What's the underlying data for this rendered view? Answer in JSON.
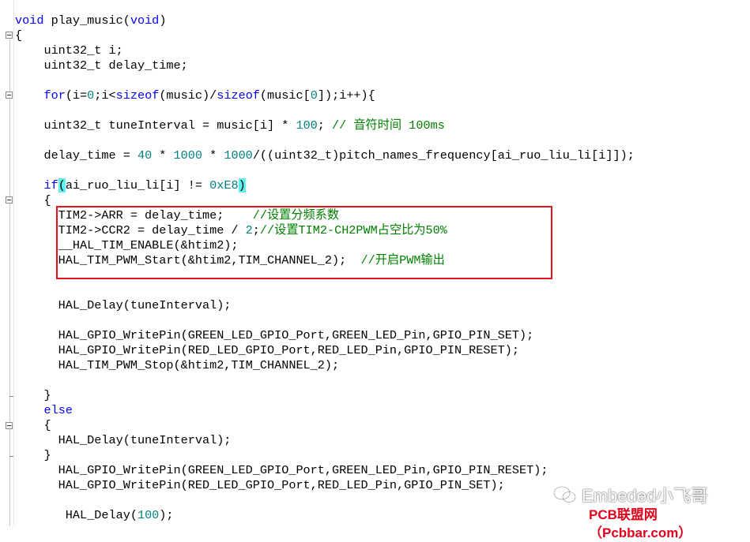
{
  "code": {
    "lines": [
      {
        "id": "l1",
        "parts": [
          {
            "t": "void",
            "c": "kw"
          },
          {
            "t": " play_music("
          },
          {
            "t": "void",
            "c": "kw"
          },
          {
            "t": ")"
          }
        ]
      },
      {
        "id": "l2",
        "parts": [
          {
            "t": "{"
          }
        ]
      },
      {
        "id": "l3",
        "parts": [
          {
            "t": "    uint32_t i;"
          }
        ]
      },
      {
        "id": "l4",
        "parts": [
          {
            "t": "    uint32_t delay_time;"
          }
        ]
      },
      {
        "id": "l5",
        "parts": [
          {
            "t": "    "
          },
          {
            "t": "for",
            "c": "kw"
          },
          {
            "t": "(i="
          },
          {
            "t": "0",
            "c": "num"
          },
          {
            "t": ";i<"
          },
          {
            "t": "sizeof",
            "c": "kw"
          },
          {
            "t": "(music)/"
          },
          {
            "t": "sizeof",
            "c": "kw"
          },
          {
            "t": "(music["
          },
          {
            "t": "0",
            "c": "num"
          },
          {
            "t": "]);i++){"
          }
        ]
      },
      {
        "id": "l6",
        "parts": [
          {
            "t": "    uint32_t tuneInterval = music[i] * "
          },
          {
            "t": "100",
            "c": "num"
          },
          {
            "t": "; "
          },
          {
            "t": "// 音符时间 100ms",
            "c": "cm"
          }
        ]
      },
      {
        "id": "l7",
        "parts": [
          {
            "t": "    delay_time = "
          },
          {
            "t": "40",
            "c": "num"
          },
          {
            "t": " * "
          },
          {
            "t": "1000",
            "c": "num"
          },
          {
            "t": " * "
          },
          {
            "t": "1000",
            "c": "num"
          },
          {
            "t": "/((uint32_t)pitch_names_frequency[ai_ruo_liu_li[i]]);"
          }
        ]
      },
      {
        "id": "l8",
        "parts": [
          {
            "t": "    "
          },
          {
            "t": "if",
            "c": "kw"
          },
          {
            "t": "(",
            "c": "hl"
          },
          {
            "t": "ai_ruo_liu_li[i] != "
          },
          {
            "t": "0xE8",
            "c": "num"
          },
          {
            "t": ")",
            "c": "hl"
          }
        ]
      },
      {
        "id": "l9",
        "parts": [
          {
            "t": "    {"
          }
        ]
      },
      {
        "id": "l10",
        "parts": [
          {
            "t": "      TIM2->ARR = delay_time;    "
          },
          {
            "t": "//设置分频系数",
            "c": "cm"
          }
        ]
      },
      {
        "id": "l11",
        "parts": [
          {
            "t": "      TIM2->CCR2 = delay_time / "
          },
          {
            "t": "2",
            "c": "num"
          },
          {
            "t": ";"
          },
          {
            "t": "//设置TIM2-CH2PWM占空比为50%",
            "c": "cm"
          }
        ]
      },
      {
        "id": "l12",
        "parts": [
          {
            "t": "      __HAL_TIM_ENABLE(&htim2);"
          }
        ]
      },
      {
        "id": "l13",
        "parts": [
          {
            "t": "      HAL_TIM_PWM_Start(&htim2,TIM_CHANNEL_2);  "
          },
          {
            "t": "//开启PWM输出",
            "c": "cm"
          }
        ]
      },
      {
        "id": "l14",
        "parts": [
          {
            "t": "      HAL_Delay(tuneInterval);"
          }
        ]
      },
      {
        "id": "l15",
        "parts": [
          {
            "t": "      HAL_GPIO_WritePin(GREEN_LED_GPIO_Port,GREEN_LED_Pin,GPIO_PIN_SET);"
          }
        ]
      },
      {
        "id": "l16",
        "parts": [
          {
            "t": "      HAL_GPIO_WritePin(RED_LED_GPIO_Port,RED_LED_Pin,GPIO_PIN_RESET);"
          }
        ]
      },
      {
        "id": "l17",
        "parts": [
          {
            "t": "      HAL_TIM_PWM_Stop(&htim2,TIM_CHANNEL_2);"
          }
        ]
      },
      {
        "id": "l18",
        "parts": [
          {
            "t": "    }"
          }
        ]
      },
      {
        "id": "l19",
        "parts": [
          {
            "t": "    "
          },
          {
            "t": "else",
            "c": "kw"
          }
        ]
      },
      {
        "id": "l20",
        "parts": [
          {
            "t": "    {"
          }
        ]
      },
      {
        "id": "l21",
        "parts": [
          {
            "t": "      HAL_Delay(tuneInterval);"
          }
        ]
      },
      {
        "id": "l22",
        "parts": [
          {
            "t": "    }"
          }
        ]
      },
      {
        "id": "l23",
        "parts": [
          {
            "t": "      HAL_GPIO_WritePin(GREEN_LED_GPIO_Port,GREEN_LED_Pin,GPIO_PIN_RESET);"
          }
        ]
      },
      {
        "id": "l24",
        "parts": [
          {
            "t": "      HAL_GPIO_WritePin(RED_LED_GPIO_Port,RED_LED_Pin,GPIO_PIN_SET);"
          }
        ]
      },
      {
        "id": "l25",
        "parts": [
          {
            "t": "       HAL_Delay("
          },
          {
            "t": "100",
            "c": "num"
          },
          {
            "t": ");"
          }
        ]
      }
    ]
  },
  "watermark": {
    "text": "Embeded小飞哥",
    "icon": "wechat-icon"
  },
  "source_badge": {
    "text": "PCB联盟网（Pcbbar.com）"
  },
  "colors": {
    "keyword": "#0000ff",
    "number": "#008080",
    "comment": "#008000",
    "highlight": "#5ff0f0",
    "box": "#e0141e"
  }
}
